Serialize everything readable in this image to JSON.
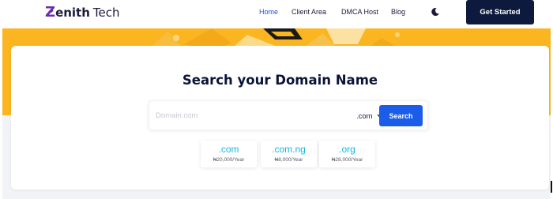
{
  "brand": {
    "logo_letter": "Z",
    "logo_rest": "enith",
    "logo_second": "Tech"
  },
  "nav": {
    "items": [
      {
        "label": "Home",
        "active": true
      },
      {
        "label": "Client Area",
        "active": false
      },
      {
        "label": "DMCA Host",
        "active": false
      },
      {
        "label": "Blog",
        "active": false
      }
    ],
    "theme_icon": "moon-icon",
    "cta_label": "Get Started"
  },
  "search": {
    "title": "Search your Domain Name",
    "placeholder": "Domain.com",
    "value": "",
    "tld_selected": ".com",
    "button_label": "Search"
  },
  "tlds": [
    {
      "ext": ".com",
      "price": "₦20,000/Year"
    },
    {
      "ext": ".com.ng",
      "price": "₦8,000/Year"
    },
    {
      "ext": ".org",
      "price": "₦28,000/Year"
    }
  ],
  "colors": {
    "hero_yellow": "#fbb521",
    "navy": "#0d1a3d",
    "accent_blue": "#1b5ce8",
    "tld_cyan": "#17b6e6",
    "brand_purple": "#6b2fa8"
  }
}
